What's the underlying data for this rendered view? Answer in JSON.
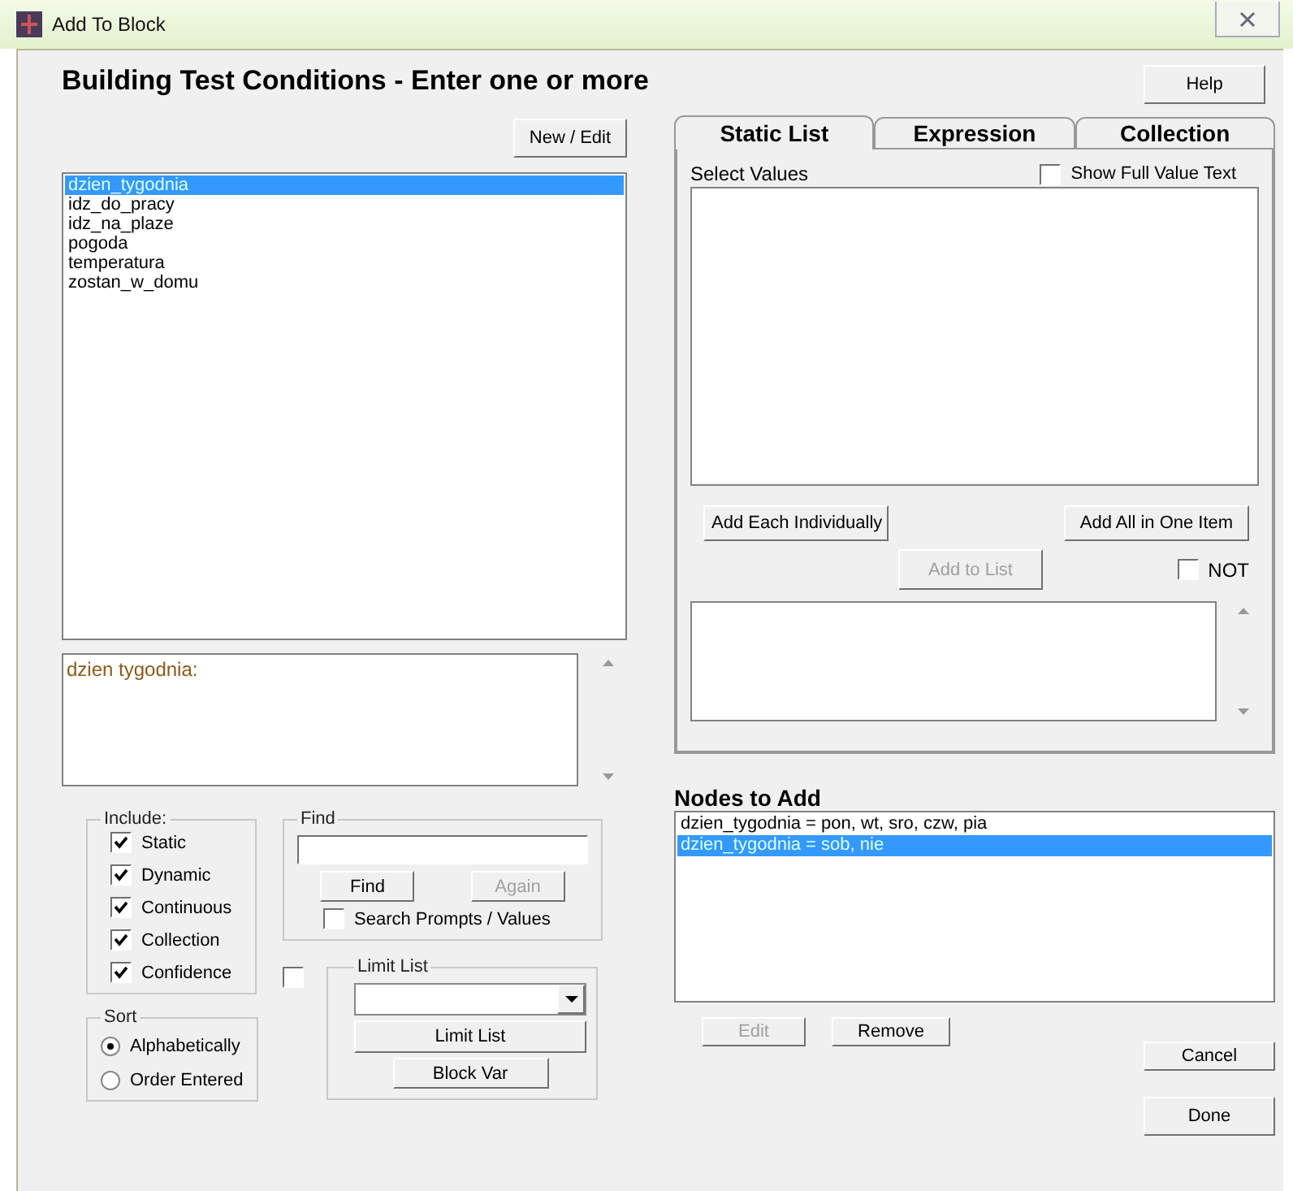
{
  "window": {
    "title": "Add To Block"
  },
  "heading": "Building Test Conditions - Enter one or more",
  "help_button": "Help",
  "new_edit_button": "New / Edit",
  "variables": [
    {
      "label": "dzien_tygodnia",
      "selected": true
    },
    {
      "label": "idz_do_pracy",
      "selected": false
    },
    {
      "label": "idz_na_plaze",
      "selected": false
    },
    {
      "label": "pogoda",
      "selected": false
    },
    {
      "label": "temperatura",
      "selected": false
    },
    {
      "label": "zostan_w_domu",
      "selected": false
    }
  ],
  "description": "dzien tygodnia:",
  "include": {
    "title": "Include:",
    "options": [
      {
        "label": "Static",
        "checked": true
      },
      {
        "label": "Dynamic",
        "checked": true
      },
      {
        "label": "Continuous",
        "checked": true
      },
      {
        "label": "Collection",
        "checked": true
      },
      {
        "label": "Confidence",
        "checked": true
      }
    ]
  },
  "sort": {
    "title": "Sort",
    "options": [
      {
        "label": "Alphabetically",
        "selected": true
      },
      {
        "label": "Order Entered",
        "selected": false
      }
    ]
  },
  "find": {
    "title": "Find",
    "find_button": {
      "label": "Find",
      "disabled": false
    },
    "again_button": {
      "label": "Again",
      "disabled": true
    },
    "search_prompts": {
      "label": "Search Prompts / Values",
      "checked": false
    }
  },
  "limit": {
    "checked": false,
    "title": "Limit List",
    "limit_button": "Limit List",
    "block_var_button": "Block Var"
  },
  "tabs": [
    {
      "label": "Static List",
      "selected": true
    },
    {
      "label": "Expression",
      "selected": false
    },
    {
      "label": "Collection",
      "selected": false
    }
  ],
  "static_list": {
    "select_values_label": "Select Values",
    "show_full_text": {
      "label": "Show Full Value Text",
      "checked": false
    },
    "add_each_button": {
      "label": "Add Each Individually",
      "disabled": false
    },
    "add_all_button": {
      "label": "Add All in One Item",
      "disabled": false
    },
    "add_to_list_button": {
      "label": "Add to List",
      "disabled": true
    },
    "not": {
      "label": "NOT",
      "checked": false
    }
  },
  "nodes": {
    "title": "Nodes to Add",
    "items": [
      {
        "label": "dzien_tygodnia = pon, wt, sro, czw, pia",
        "selected": false
      },
      {
        "label": "dzien_tygodnia = sob, nie",
        "selected": true
      }
    ]
  },
  "edit_button": {
    "label": "Edit",
    "disabled": true
  },
  "remove_button": {
    "label": "Remove",
    "disabled": false
  },
  "cancel_button": "Cancel",
  "done_button": "Done"
}
